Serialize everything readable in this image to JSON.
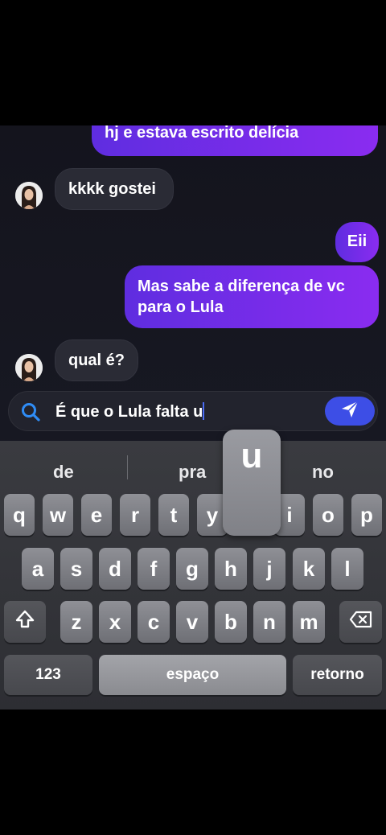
{
  "chat": {
    "messages": [
      {
        "from": "me",
        "text": "hj e estava escrito delícia"
      },
      {
        "from": "them",
        "text": "kkkk gostei"
      },
      {
        "from": "me",
        "text": "Eii"
      },
      {
        "from": "me",
        "text_line1": "Mas sabe a diferença de vc",
        "text_line2": "para o Lula"
      },
      {
        "from": "them",
        "text": "qual é?"
      }
    ],
    "input": {
      "value": "É que o Lula falta u"
    }
  },
  "keyboard": {
    "suggestions": [
      "de",
      "pra",
      "no"
    ],
    "popup_key": "u",
    "row1": [
      "q",
      "w",
      "e",
      "r",
      "t",
      "y",
      "u",
      "i",
      "o",
      "p"
    ],
    "row2": [
      "a",
      "s",
      "d",
      "f",
      "g",
      "h",
      "j",
      "k",
      "l"
    ],
    "row3": [
      "z",
      "x",
      "c",
      "v",
      "b",
      "n",
      "m"
    ],
    "numbers_label": "123",
    "space_label": "espaço",
    "return_label": "retorno"
  },
  "colors": {
    "accent": "#3d4ee6",
    "bubble_out": "#7a2ef0",
    "bubble_in": "#2a2b35"
  },
  "icons": [
    "avatar",
    "search-icon",
    "send-icon",
    "shift-icon",
    "backspace-icon"
  ]
}
